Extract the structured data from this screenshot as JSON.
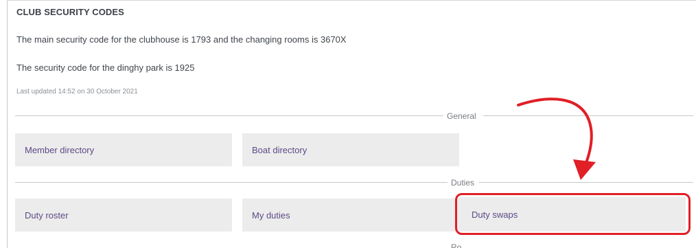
{
  "security": {
    "title": "CLUB SECURITY CODES",
    "clubhouse_text": "The main security code for the clubhouse is 1793 and the changing rooms is 3670X",
    "dinghy_text": "The security code for the dinghy park is 1925",
    "last_updated": "Last updated 14:52 on 30 October 2021"
  },
  "sections": {
    "general": {
      "label": "General",
      "tiles": [
        "Member directory",
        "Boat directory"
      ]
    },
    "duties": {
      "label": "Duties",
      "tiles": [
        "Duty roster",
        "My duties",
        "Duty swaps"
      ]
    },
    "next_label_partial": "Ro"
  },
  "annotation": {
    "color": "#e01f26",
    "highlighted_item": "Duty swaps"
  },
  "colors": {
    "tile_background": "#ececec",
    "tile_text": "#5b4a86",
    "divider": "#c8c8c8"
  }
}
